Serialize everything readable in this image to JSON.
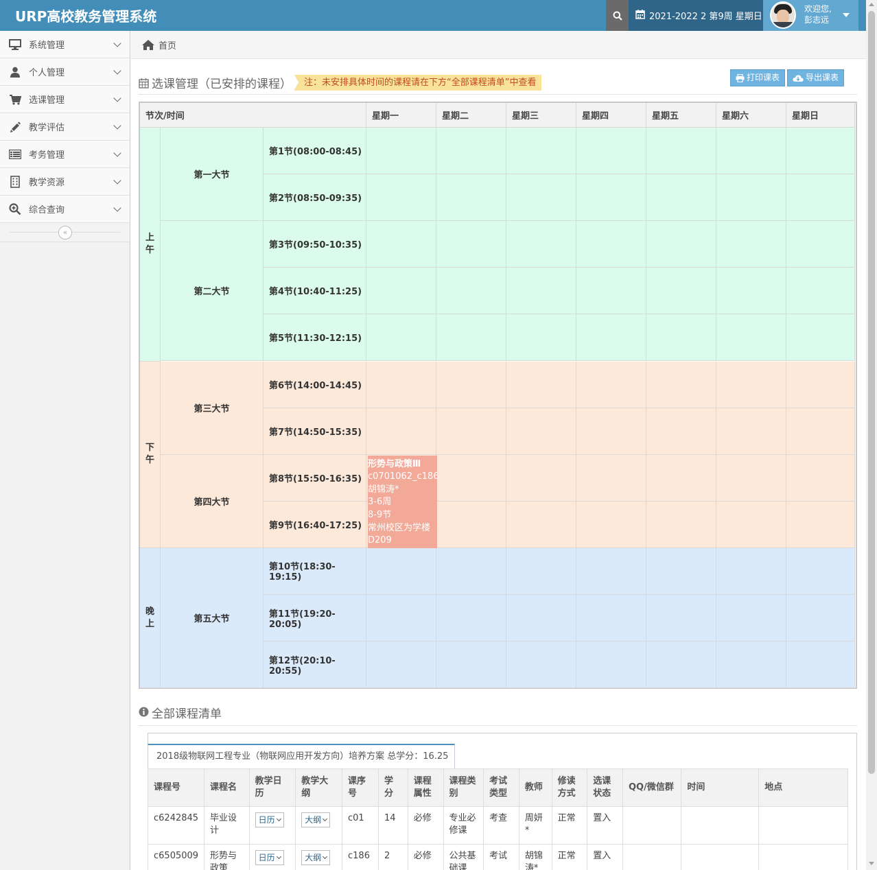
{
  "app": {
    "title": "URP高校教务管理系统",
    "date_label": "2021-2022 2 第9周 星期日",
    "welcome": "欢迎您,",
    "user_name": "彭志远"
  },
  "sidebar": {
    "items": [
      {
        "label": "系统管理",
        "icon": "desktop-icon"
      },
      {
        "label": "个人管理",
        "icon": "user-icon"
      },
      {
        "label": "选课管理",
        "icon": "cart-icon"
      },
      {
        "label": "教学评估",
        "icon": "pencil-icon"
      },
      {
        "label": "考务管理",
        "icon": "list-icon"
      },
      {
        "label": "教学资源",
        "icon": "building-icon"
      },
      {
        "label": "综合查询",
        "icon": "search-plus-icon"
      }
    ],
    "collapse_glyph": "«"
  },
  "breadcrumb": {
    "home": "首页"
  },
  "schedule": {
    "title": "选课管理（已安排的课程）",
    "note": "注：未安排具体时间的课程请在下方“全部课程清单”中查看",
    "print_label": "打印课表",
    "export_label": "导出课表",
    "header_first": "节次/时间",
    "days": [
      "星期一",
      "星期二",
      "星期三",
      "星期四",
      "星期五",
      "星期六",
      "星期日"
    ],
    "periods": [
      {
        "label": "上\n午",
        "color": "#dbfbed"
      },
      {
        "label": "下\n午",
        "color": "#fde9d9"
      },
      {
        "label": "晚\n上",
        "color": "#dbeafb"
      }
    ],
    "big_sections": [
      "第一大节",
      "第二大节",
      "第三大节",
      "第四大节",
      "第五大节"
    ],
    "slots": [
      "第1节(08:00-08:45)",
      "第2节(08:50-09:35)",
      "第3节(09:50-10:35)",
      "第4节(10:40-11:25)",
      "第5节(11:30-12:15)",
      "第6节(14:00-14:45)",
      "第7节(14:50-15:35)",
      "第8节(15:50-16:35)",
      "第9节(16:40-17:25)",
      "第10节(18:30-19:15)",
      "第11节(19:20-20:05)",
      "第12节(20:10-20:55)"
    ],
    "course": {
      "name": "形势与政策Ⅲ",
      "code": "c0701062_c186",
      "teacher": "胡锦涛*",
      "weeks": "3-6周",
      "sections": "8-9节",
      "location": "常州校区为学楼",
      "room": "D209",
      "day_index": 0,
      "slot_start": 8,
      "slot_end": 9,
      "color": "#f2a998"
    }
  },
  "course_list": {
    "title": "全部课程清单",
    "plan_tab": "2018级物联网工程专业（物联网应用开发方向）培养方案  总学分：16.25",
    "columns": [
      "课程号",
      "课程名",
      "教学日历",
      "教学大纲",
      "课序号",
      "学分",
      "课程属性",
      "课程类别",
      "考试类型",
      "教师",
      "修读方式",
      "选课状态",
      "QQ/微信群",
      "时间",
      "地点"
    ],
    "calendar_label": "日历",
    "syllabus_label": "大纲",
    "rows": [
      {
        "code": "c6242845",
        "name": "毕业设计",
        "seq": "c01",
        "credit": "14",
        "attr": "必修",
        "category": "专业必修课",
        "exam": "考查",
        "teacher": "周妍*",
        "mode": "正常",
        "status": "置入",
        "qq": "",
        "time": "",
        "place": ""
      },
      {
        "code": "c6505009",
        "name": "形势与政策",
        "seq": "c186",
        "credit": "2",
        "attr": "必修",
        "category": "公共基础课",
        "exam": "考试",
        "teacher": "胡锦涛*",
        "mode": "正常",
        "status": "置入",
        "qq": "",
        "time": "",
        "place": ""
      }
    ]
  }
}
